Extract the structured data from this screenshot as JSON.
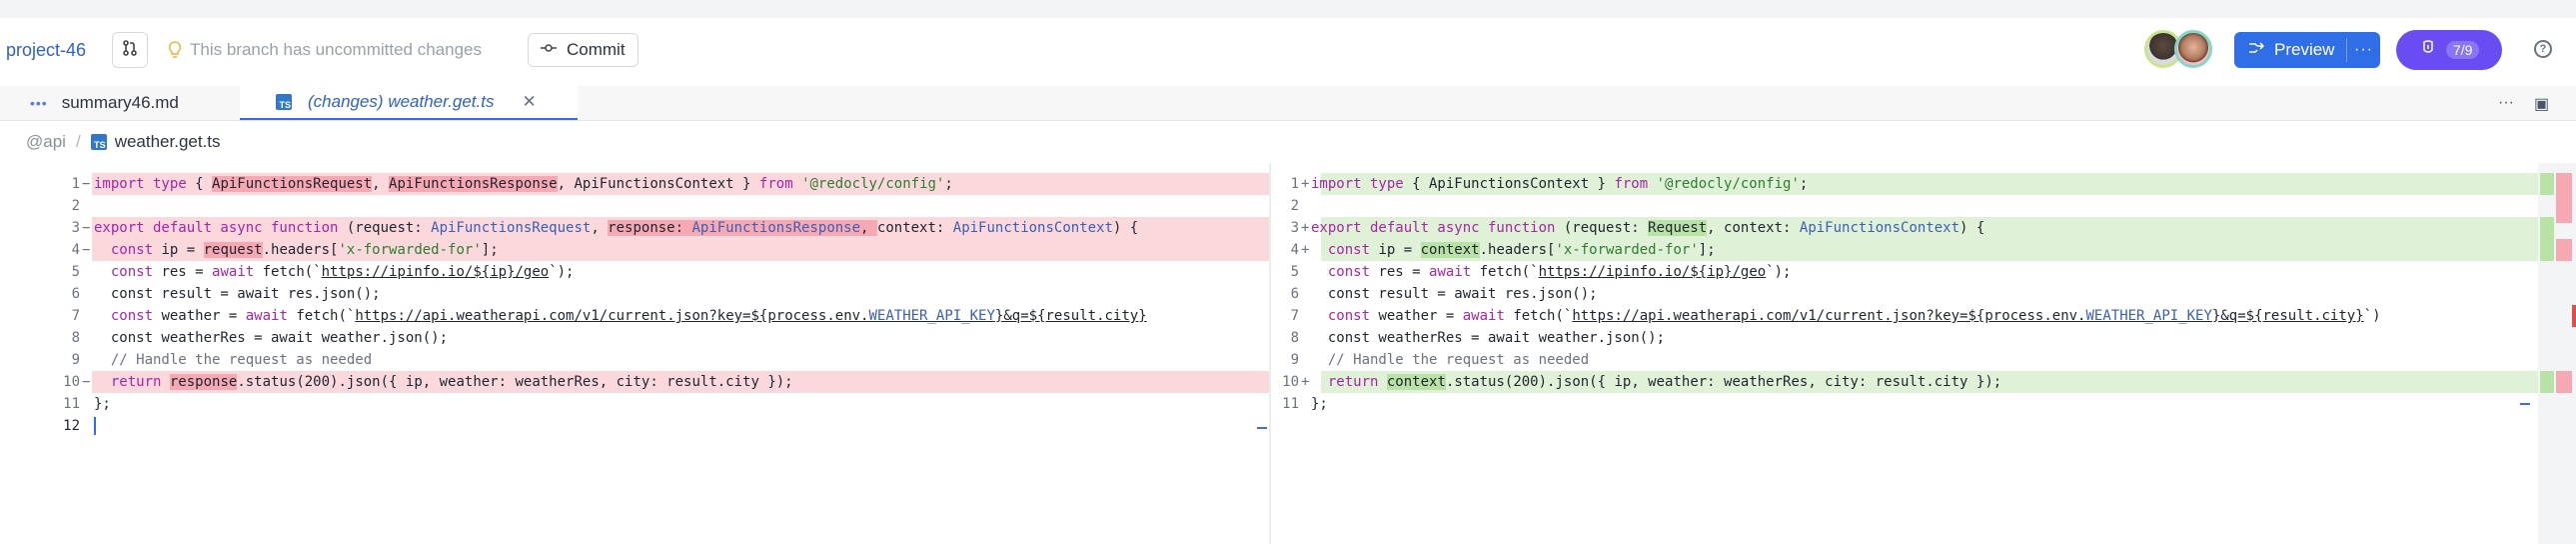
{
  "toolbar": {
    "project": "project-46",
    "warning": "This branch has uncommitted changes",
    "commit_label": "Commit",
    "preview_label": "Preview",
    "preview_more": "···",
    "ai_count": "7/9",
    "help": "?"
  },
  "tabs": [
    {
      "label": "summary46.md",
      "icon": "markdown-icon",
      "active": false
    },
    {
      "label": "(changes) weather.get.ts",
      "icon": "typescript-icon",
      "active": true,
      "close": "✕"
    }
  ],
  "tabs_right": {
    "more": "···",
    "split": "▣"
  },
  "breadcrumb": {
    "folder": "@api",
    "separator": "/",
    "file": "weather.get.ts"
  },
  "diff": {
    "left": {
      "lines": [
        {
          "n": "1",
          "m": "−",
          "status": "removed",
          "text": "import type { ApiFunctionsRequest, ApiFunctionsResponse, ApiFunctionsContext } from '@redocly/config';"
        },
        {
          "n": "2",
          "m": "",
          "status": "normal",
          "text": ""
        },
        {
          "n": "3",
          "m": "−",
          "status": "removed",
          "text": "export default async function (request: ApiFunctionsRequest, response: ApiFunctionsResponse, context: ApiFunctionsContext) {"
        },
        {
          "n": "4",
          "m": "−",
          "status": "removed",
          "text": "  const ip = request.headers['x-forwarded-for'];"
        },
        {
          "n": "5",
          "m": "",
          "status": "normal",
          "text": "  const res = await fetch(`https://ipinfo.io/${ip}/geo`);"
        },
        {
          "n": "6",
          "m": "",
          "status": "normal",
          "text": "  const result = await res.json();"
        },
        {
          "n": "7",
          "m": "",
          "status": "normal",
          "text": "  const weather = await fetch(`https://api.weatherapi.com/v1/current.json?key=${process.env.WEATHER_API_KEY}&q=${result.city}"
        },
        {
          "n": "8",
          "m": "",
          "status": "normal",
          "text": "  const weatherRes = await weather.json();"
        },
        {
          "n": "9",
          "m": "",
          "status": "normal",
          "text": "  // Handle the request as needed"
        },
        {
          "n": "10",
          "m": "−",
          "status": "removed",
          "text": "  return response.status(200).json({ ip, weather: weatherRes, city: result.city });"
        },
        {
          "n": "11",
          "m": "",
          "status": "normal",
          "text": "};"
        },
        {
          "n": "12",
          "m": "",
          "status": "normal",
          "text": ""
        }
      ]
    },
    "right": {
      "lines": [
        {
          "n": "1",
          "m": "+",
          "status": "added",
          "text": "import type { ApiFunctionsContext } from '@redocly/config';"
        },
        {
          "n": "2",
          "m": "",
          "status": "normal",
          "text": ""
        },
        {
          "n": "3",
          "m": "+",
          "status": "added",
          "text": "export default async function (request: Request, context: ApiFunctionsContext) {"
        },
        {
          "n": "4",
          "m": "+",
          "status": "added",
          "text": "  const ip = context.headers['x-forwarded-for'];"
        },
        {
          "n": "5",
          "m": "",
          "status": "normal",
          "text": "  const res = await fetch(`https://ipinfo.io/${ip}/geo`);"
        },
        {
          "n": "6",
          "m": "",
          "status": "normal",
          "text": "  const result = await res.json();"
        },
        {
          "n": "7",
          "m": "",
          "status": "normal",
          "text": "  const weather = await fetch(`https://api.weatherapi.com/v1/current.json?key=${process.env.WEATHER_API_KEY}&q=${result.city}`)"
        },
        {
          "n": "8",
          "m": "",
          "status": "normal",
          "text": "  const weatherRes = await weather.json();"
        },
        {
          "n": "9",
          "m": "",
          "status": "normal",
          "text": "  // Handle the request as needed"
        },
        {
          "n": "10",
          "m": "+",
          "status": "added",
          "text": "  return context.status(200).json({ ip, weather: weatherRes, city: result.city });"
        },
        {
          "n": "11",
          "m": "",
          "status": "normal",
          "text": "};"
        }
      ]
    }
  },
  "colors": {
    "removed_line": "#fde8ea",
    "removed_token": "#f6a9b2",
    "added_line": "#e6f5de",
    "added_token": "#b9e3a6",
    "accent": "#2f6ee6",
    "ai_button": "#6a4df2"
  }
}
